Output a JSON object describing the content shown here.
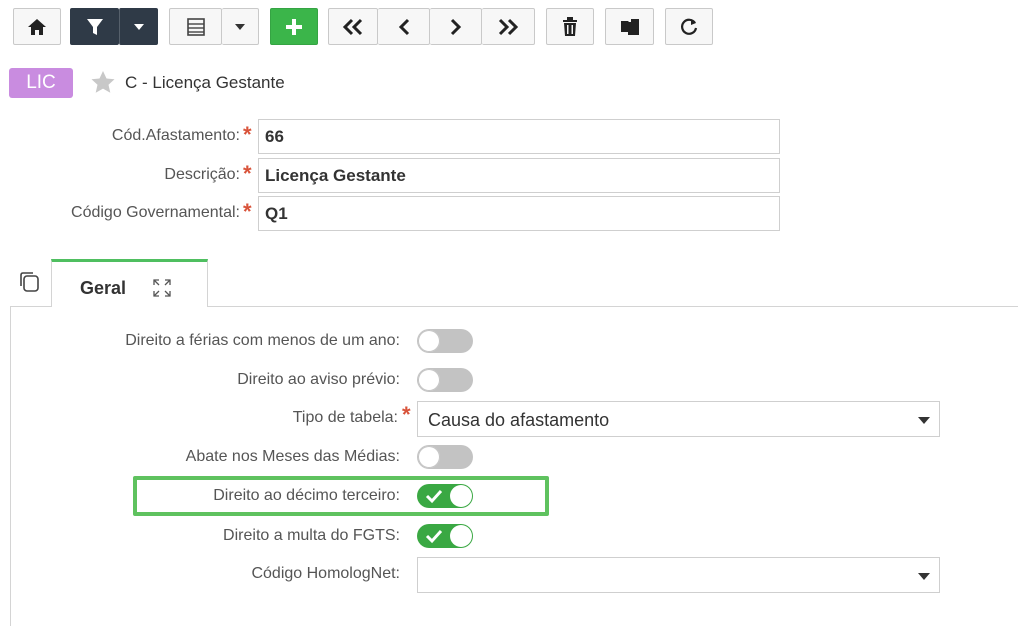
{
  "toolbar": {
    "buttons": [
      {
        "name": "home",
        "icon": "home-icon"
      },
      {
        "name": "filter",
        "icon": "filter-icon"
      },
      {
        "name": "filter-dropdown",
        "icon": "caret-down-icon"
      },
      {
        "name": "list-view",
        "icon": "list-icon"
      },
      {
        "name": "list-dropdown",
        "icon": "caret-down-icon"
      },
      {
        "name": "add",
        "icon": "plus-icon"
      },
      {
        "name": "first",
        "icon": "double-chevron-left-icon"
      },
      {
        "name": "previous",
        "icon": "chevron-left-icon"
      },
      {
        "name": "next",
        "icon": "chevron-right-icon"
      },
      {
        "name": "last",
        "icon": "double-chevron-right-icon"
      },
      {
        "name": "delete",
        "icon": "trash-icon"
      },
      {
        "name": "copy",
        "icon": "copy-icon"
      },
      {
        "name": "refresh",
        "icon": "refresh-icon"
      }
    ]
  },
  "header": {
    "badge": "LIC",
    "title": "C - Licença Gestante"
  },
  "form": {
    "cod_afastamento": {
      "label": "Cód.Afastamento:",
      "value": "66"
    },
    "descricao": {
      "label": "Descrição:",
      "value": "Licença Gestante"
    },
    "codigo_governamental": {
      "label": "Código Governamental:",
      "value": "Q1"
    }
  },
  "tabs": [
    {
      "label": "Geral",
      "active": true
    }
  ],
  "panel": {
    "ferias_menos_um_ano": {
      "label": "Direito a férias com menos de um ano:",
      "on": false
    },
    "aviso_previo": {
      "label": "Direito ao aviso prévio:",
      "on": false
    },
    "tipo_tabela": {
      "label": "Tipo de tabela:",
      "value": "Causa do afastamento"
    },
    "abate_meses": {
      "label": "Abate nos Meses das Médias:",
      "on": false
    },
    "decimo_terceiro": {
      "label": "Direito ao décimo terceiro:",
      "on": true
    },
    "multa_fgts": {
      "label": "Direito a multa do FGTS:",
      "on": true
    },
    "codigo_homolognet": {
      "label": "Código HomologNet:",
      "value": ""
    }
  },
  "colors": {
    "accent_green": "#3bb54a",
    "toggle_on": "#3aa843",
    "badge": "#c98ce0",
    "required": "#d9533a",
    "toolbar_dark": "#2f3a47",
    "highlight": "#5fc25f"
  }
}
